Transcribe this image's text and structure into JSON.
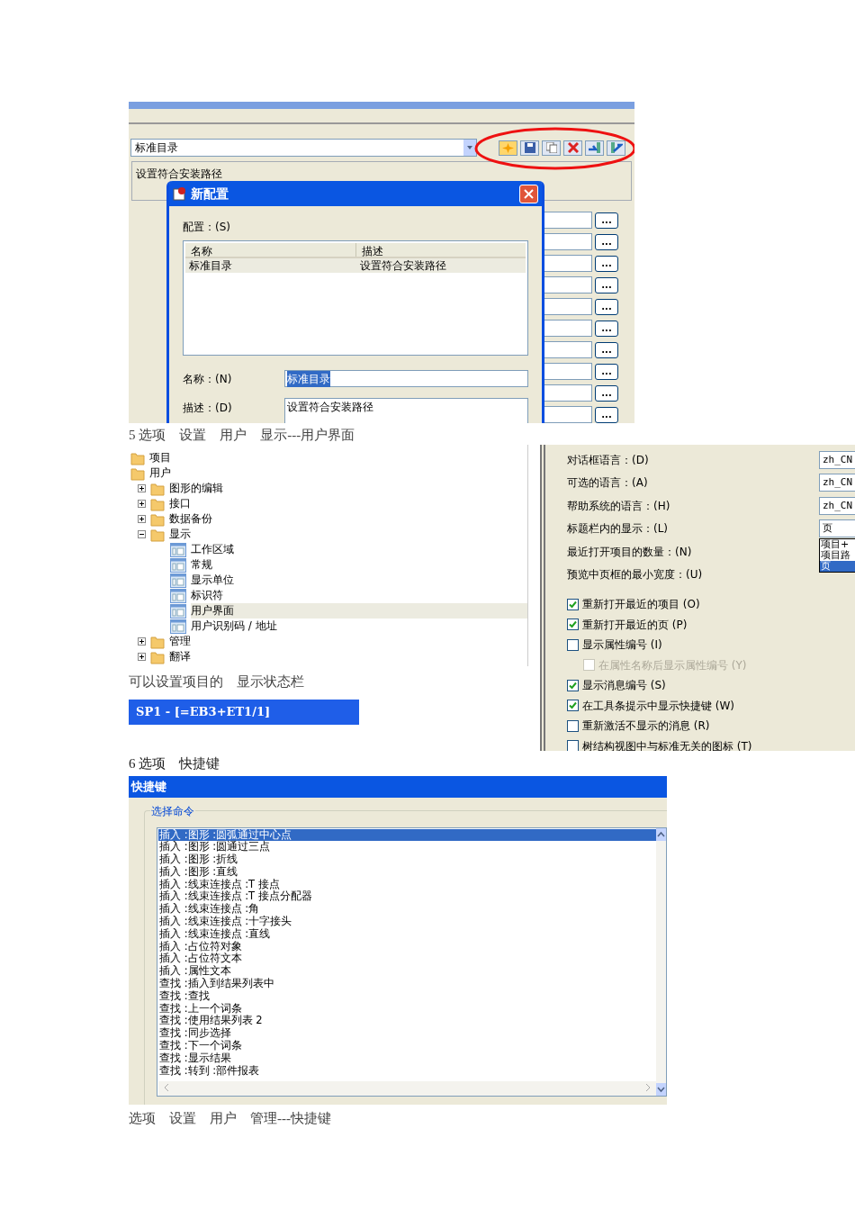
{
  "config_window": {
    "combo_value": "标准目录",
    "description": "设置符合安装路径",
    "toolbar": [
      {
        "kind": "new"
      },
      {
        "kind": "save"
      },
      {
        "kind": "copy"
      },
      {
        "kind": "delete"
      },
      {
        "kind": "import"
      },
      {
        "kind": "export"
      }
    ],
    "browse_buttons": [
      "...",
      "...",
      "...",
      "...",
      "...",
      "...",
      "...",
      "...",
      "...",
      "..."
    ]
  },
  "dialog": {
    "title": "新配置",
    "list_label": "配置：(S)",
    "columns": [
      "名称",
      "描述"
    ],
    "rows": [
      {
        "cells": [
          "标准目录",
          "设置符合安装路径"
        ],
        "selected": true
      }
    ],
    "name_label": "名称：(N)",
    "name_value": "标准目录",
    "desc_label": "描述：(D)",
    "desc_value": "设置符合安装路径"
  },
  "caption_user_interface": "5 选项　设置　用户　显示---用户界面",
  "tree": [
    {
      "label": "项目",
      "kind": "folder"
    },
    {
      "label": "用户",
      "kind": "folder",
      "children": [
        {
          "label": "图形的编辑",
          "kind": "folder",
          "expanded": false
        },
        {
          "label": "接口",
          "kind": "folder",
          "expanded": false
        },
        {
          "label": "数据备份",
          "kind": "folder",
          "expanded": false
        },
        {
          "label": "显示",
          "kind": "folder",
          "expanded": true,
          "children": [
            {
              "label": "工作区域",
              "kind": "page",
              "selected": false
            },
            {
              "label": "常规",
              "kind": "page",
              "selected": false
            },
            {
              "label": "显示单位",
              "kind": "page",
              "selected": false
            },
            {
              "label": "标识符",
              "kind": "page",
              "selected": false
            },
            {
              "label": "用户界面",
              "kind": "page",
              "selected": true
            },
            {
              "label": "用户识别码 / 地址",
              "kind": "page",
              "selected": false
            }
          ]
        },
        {
          "label": "管理",
          "kind": "folder",
          "expanded": false
        },
        {
          "label": "翻译",
          "kind": "folder",
          "expanded": false
        }
      ]
    }
  ],
  "caption_status_bar": "可以设置项目的　显示状态栏",
  "main_window_title": "SP1 - [=EB3+ET1/1]",
  "options": {
    "fields": [
      {
        "label": "对话框语言：(D)",
        "value": "zh_CN"
      },
      {
        "label": "可选的语言：(A)",
        "value": "zh_CN"
      },
      {
        "label": "帮助系统的语言：(H)",
        "value": "zh_CN"
      },
      {
        "label": "标题栏内的显示：(L)",
        "value": "页",
        "dropdown": [
          {
            "label": "项目+",
            "selected": false
          },
          {
            "label": "项目路",
            "selected": false
          },
          {
            "label": "页",
            "selected": true
          }
        ]
      },
      {
        "label": "最近打开项目的数量：(N)"
      },
      {
        "label": "预览中页框的最小宽度：(U)"
      }
    ],
    "checkboxes": [
      {
        "label": "重新打开最近的项目 (O)",
        "checked": true,
        "disabled": false
      },
      {
        "label": "重新打开最近的页 (P)",
        "checked": true,
        "disabled": false
      },
      {
        "label": "显示属性编号 (I)",
        "checked": false,
        "disabled": false,
        "children": [
          {
            "label": "在属性名称后显示属性编号 (Y)",
            "checked": false,
            "disabled": true
          }
        ]
      },
      {
        "label": "显示消息编号 (S)",
        "checked": true,
        "disabled": false
      },
      {
        "label": "在工具条提示中显示快捷键 (W)",
        "checked": true,
        "disabled": false
      },
      {
        "label": "重新激活不显示的消息 (R)",
        "checked": false,
        "disabled": false
      },
      {
        "label": "树结构视图中与标准无关的图标 (T)",
        "checked": false,
        "disabled": false
      }
    ]
  },
  "caption_shortcuts_section": "6 选项　快捷键",
  "shortcuts": {
    "title": "快捷键",
    "group_label": "选择命令",
    "commands": [
      {
        "label": "插入 :图形 :圆弧通过中心点",
        "selected": true
      },
      {
        "label": "插入 :图形 :圆通过三点",
        "selected": false
      },
      {
        "label": "插入 :图形 :折线",
        "selected": false
      },
      {
        "label": "插入 :图形 :直线",
        "selected": false
      },
      {
        "label": "插入 :线束连接点 :T 接点",
        "selected": false
      },
      {
        "label": "插入 :线束连接点 :T 接点分配器",
        "selected": false
      },
      {
        "label": "插入 :线束连接点 :角",
        "selected": false
      },
      {
        "label": "插入 :线束连接点 :十字接头",
        "selected": false
      },
      {
        "label": "插入 :线束连接点 :直线",
        "selected": false
      },
      {
        "label": "插入 :占位符对象",
        "selected": false
      },
      {
        "label": "插入 :占位符文本",
        "selected": false
      },
      {
        "label": "插入 :属性文本",
        "selected": false
      },
      {
        "label": "查找 :插入到结果列表中",
        "selected": false
      },
      {
        "label": "查找 :查找",
        "selected": false
      },
      {
        "label": "查找 :上一个词条",
        "selected": false
      },
      {
        "label": "查找 :使用结果列表 2",
        "selected": false
      },
      {
        "label": "查找 :同步选择",
        "selected": false
      },
      {
        "label": "查找 :下一个词条",
        "selected": false
      },
      {
        "label": "查找 :显示结果",
        "selected": false
      },
      {
        "label": "查找 :转到 :部件报表",
        "selected": false
      }
    ]
  },
  "caption_shortcuts": "选项　设置　用户　管理---快捷键"
}
